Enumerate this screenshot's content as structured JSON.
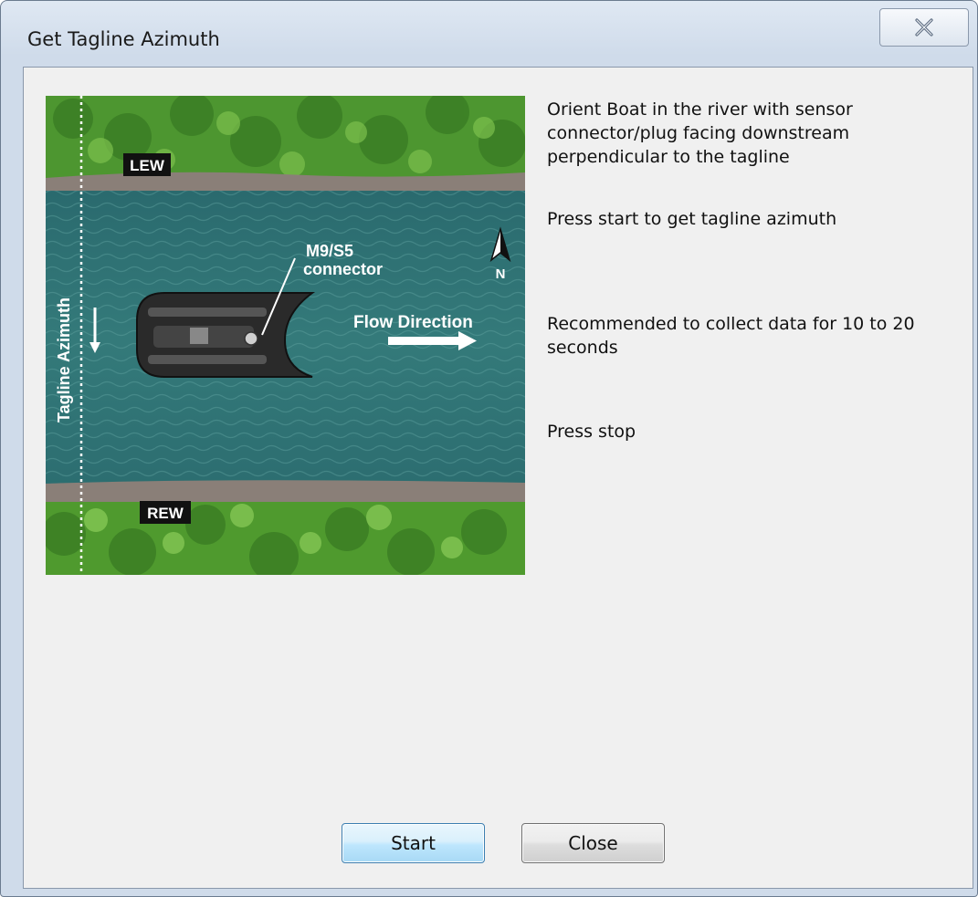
{
  "window": {
    "title": "Get Tagline Azimuth",
    "close_icon": "close-icon"
  },
  "figure": {
    "label_lew": "LEW",
    "label_rew": "REW",
    "label_tagline": "Tagline Azimuth",
    "label_connector_line1": "M9/S5",
    "label_connector_line2": "connector",
    "label_flow": "Flow Direction",
    "label_north": "N",
    "colors": {
      "water": "#2f6f72",
      "vegetation": "#4f9a2e",
      "bank": "#8a7f78"
    }
  },
  "instructions": {
    "step1": "Orient Boat in the river with sensor connector/plug facing downstream perpendicular to the tagline",
    "step2": "Press start to get tagline azimuth",
    "step3": "Recommended to collect data for 10 to 20 seconds",
    "step4": "Press stop"
  },
  "buttons": {
    "start_label": "Start",
    "close_label": "Close"
  }
}
